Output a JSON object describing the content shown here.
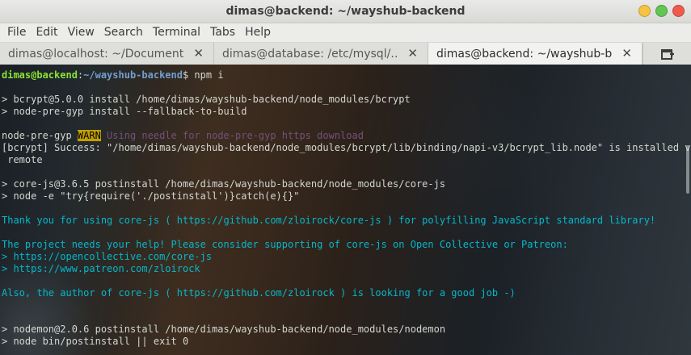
{
  "window": {
    "title": "dimas@backend: ~/wayshub-backend"
  },
  "menu": [
    "File",
    "Edit",
    "View",
    "Search",
    "Terminal",
    "Tabs",
    "Help"
  ],
  "tabs": [
    {
      "label": "dimas@localhost: ~/Document…",
      "close": "✕"
    },
    {
      "label": "dimas@database: /etc/mysql/…",
      "close": "✕"
    },
    {
      "label": "dimas@backend: ~/wayshub-b…",
      "close": "✕"
    }
  ],
  "terminal": {
    "prompt_user": "dimas@backend",
    "prompt_sep": ":",
    "prompt_path": "~/wayshub-backend",
    "prompt_cmd": "$ npm i",
    "l3": "> bcrypt@5.0.0 install /home/dimas/wayshub-backend/node_modules/bcrypt",
    "l4": "> node-pre-gyp install --fallback-to-build",
    "l6_prefix": "node-pre-gyp ",
    "l6_warn": "WARN",
    "l6_msg": " Using needle for node-pre-gyp https download",
    "l7": "[bcrypt] Success: \"/home/dimas/wayshub-backend/node_modules/bcrypt/lib/binding/napi-v3/bcrypt_lib.node\" is installed via",
    "l8": " remote",
    "l10": "> core-js@3.6.5 postinstall /home/dimas/wayshub-backend/node_modules/core-js",
    "l11": "> node -e \"try{require('./postinstall')}catch(e){}\"",
    "l13": "Thank you for using core-js ( https://github.com/zloirock/core-js ) for polyfilling JavaScript standard library!",
    "l15": "The project needs your help! Please consider supporting of core-js on Open Collective or Patreon:",
    "l16": "> https://opencollective.com/core-js",
    "l17": "> https://www.patreon.com/zloirock",
    "l19": "Also, the author of core-js ( https://github.com/zloirock ) is looking for a good job -)",
    "l22": "> nodemon@2.0.6 postinstall /home/dimas/wayshub-backend/node_modules/nodemon",
    "l23": "> node bin/postinstall || exit 0"
  },
  "colors": {
    "prompt_user": "#8ae234",
    "prompt_path": "#729fcf",
    "cyan": "#06b7c9",
    "warn_bg": "#c4a000",
    "warn_msg": "#75507b"
  },
  "icons": {
    "new_tab": "new-tab-icon",
    "tab_close": "close-icon"
  }
}
